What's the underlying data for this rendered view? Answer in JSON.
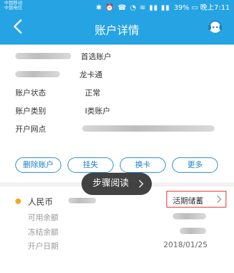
{
  "status_bar": {
    "carrier_line1": "中国移动",
    "carrier_line2": "中国电信",
    "battery": "39%",
    "time": "晚上7:11"
  },
  "header": {
    "title": "账户详情",
    "back_icon": "chevron-left-icon",
    "service_icon": "customer-service-icon"
  },
  "account_info": {
    "primary_tag": "首选账户",
    "card_type": "龙卡通",
    "status_label": "账户状态",
    "status_value": "正常",
    "type_label": "账户类别",
    "type_value": "I类账户",
    "branch_label": "开户网点"
  },
  "actions": {
    "delete": "删除账户",
    "report_loss": "挂失",
    "replace_card": "换卡",
    "more": "更多"
  },
  "currency_account": {
    "currency": "人民币",
    "deposit_button": "活期储蓄",
    "available_label": "可用余额",
    "frozen_label": "冻结余额",
    "open_date_label": "开户日期",
    "open_date_value": "2018/01/25"
  },
  "guide_toast": {
    "label": "步骤阅读"
  },
  "colors": {
    "header_bg": "#26a3e3",
    "pill_border": "#2b8fd6",
    "highlight_box": "#e53935",
    "currency_dot": "#f6a623"
  }
}
